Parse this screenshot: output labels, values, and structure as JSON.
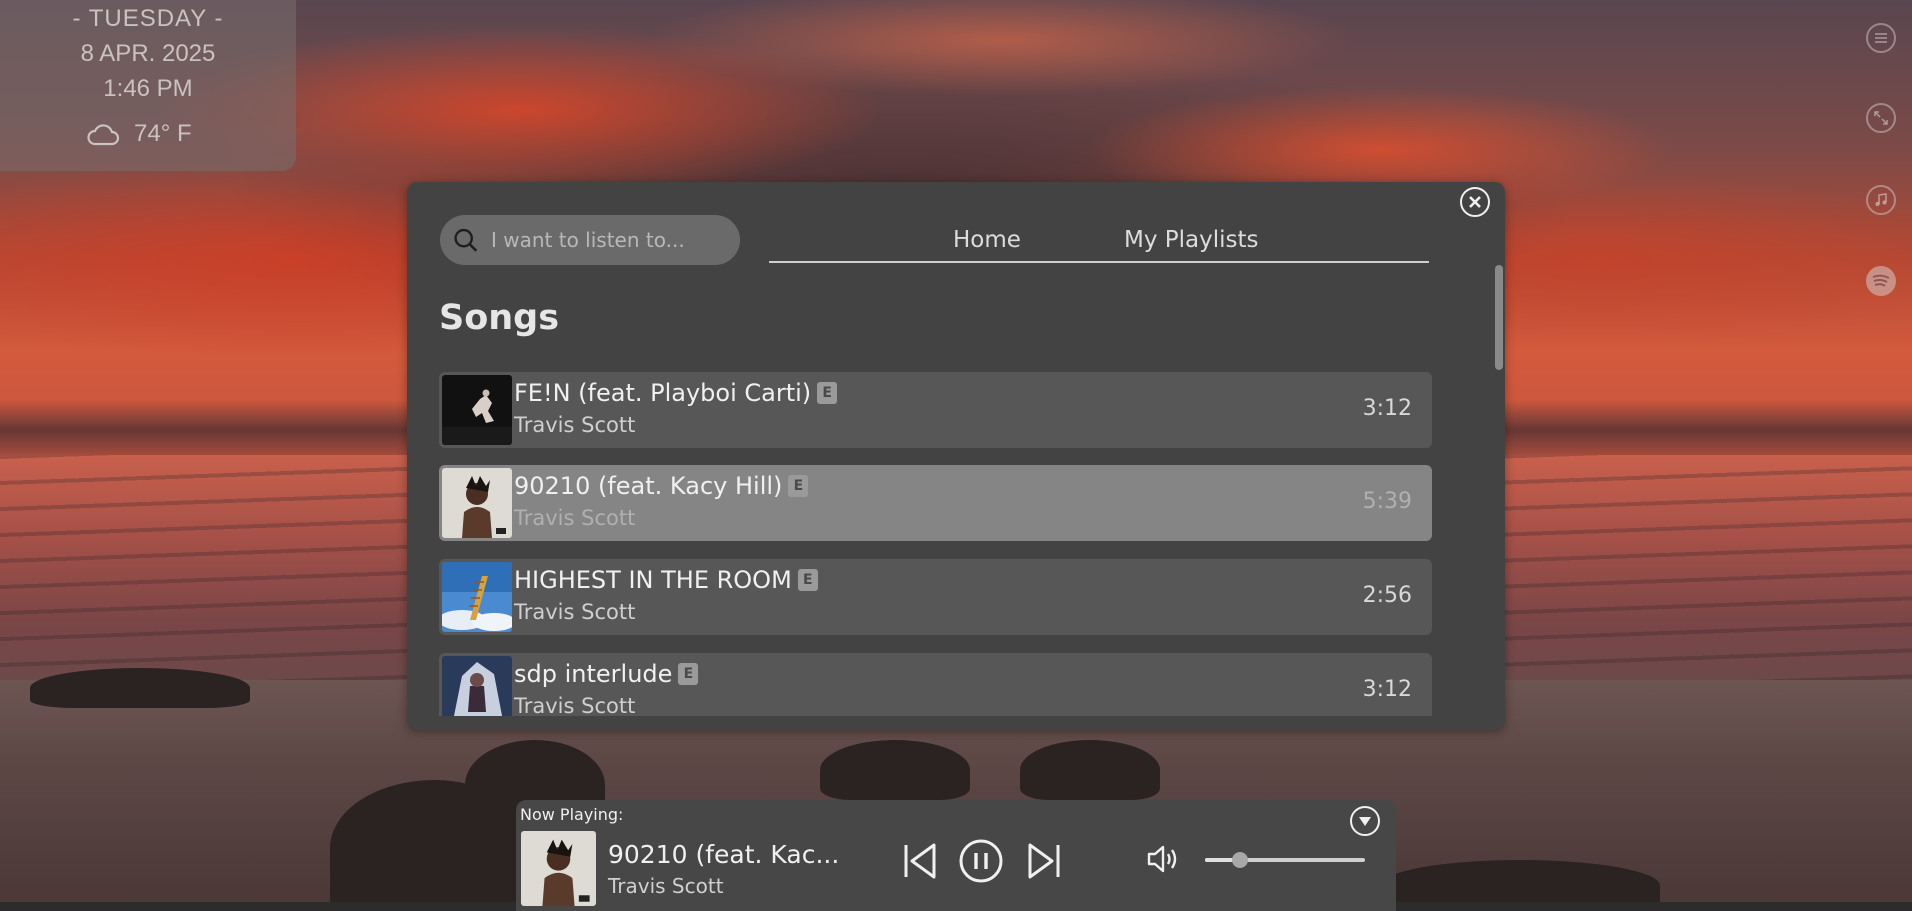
{
  "widget": {
    "day": "- TUESDAY -",
    "date": "8 APR. 2025",
    "time": "1:46 PM",
    "temperature": "74° F",
    "weather_icon": "cloud-icon"
  },
  "side_icons": [
    "menu-icon",
    "fullscreen-icon",
    "music-note-icon",
    "spotify-icon"
  ],
  "search": {
    "placeholder": "I want to listen to...",
    "value": ""
  },
  "tabs": [
    {
      "label": "Home"
    },
    {
      "label": "My Playlists"
    }
  ],
  "section_title": "Songs",
  "songs": [
    {
      "title": "FE!N (feat. Playboi Carti)",
      "artist": "Travis Scott",
      "duration": "3:12",
      "explicit": "E",
      "active": false
    },
    {
      "title": "90210 (feat. Kacy Hill)",
      "artist": "Travis Scott",
      "duration": "5:39",
      "explicit": "E",
      "active": true
    },
    {
      "title": "HIGHEST IN THE ROOM",
      "artist": "Travis Scott",
      "duration": "2:56",
      "explicit": "E",
      "active": false
    },
    {
      "title": "sdp interlude",
      "artist": "Travis Scott",
      "duration": "3:12",
      "explicit": "E",
      "active": false
    }
  ],
  "now_playing": {
    "label": "Now Playing:",
    "title": "90210 (feat. Kac...",
    "artist": "Travis Scott",
    "state": "playing",
    "volume": 0.22
  },
  "colors": {
    "panel": "#434343",
    "row": "#575757",
    "row_active": "#858585",
    "text": "#f0f0f0"
  }
}
